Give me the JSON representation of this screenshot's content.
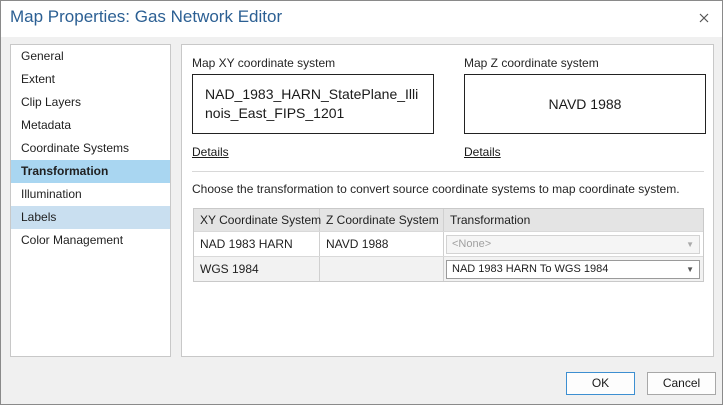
{
  "window": {
    "title": "Map Properties: Gas Network Editor",
    "close_icon": "close-icon"
  },
  "sidebar": {
    "items": [
      {
        "label": "General"
      },
      {
        "label": "Extent"
      },
      {
        "label": "Clip Layers"
      },
      {
        "label": "Metadata"
      },
      {
        "label": "Coordinate Systems"
      },
      {
        "label": "Transformation",
        "state": "selected"
      },
      {
        "label": "Illumination"
      },
      {
        "label": "Labels",
        "state": "hover"
      },
      {
        "label": "Color Management"
      }
    ]
  },
  "main": {
    "xy": {
      "label": "Map XY coordinate system",
      "value": "NAD_1983_HARN_StatePlane_Illinois_East_FIPS_1201",
      "details": "Details"
    },
    "z": {
      "label": "Map Z coordinate system",
      "value": "NAVD 1988",
      "details": "Details"
    },
    "instructions": "Choose the transformation to convert source coordinate systems to map coordinate system.",
    "table": {
      "columns": [
        "XY Coordinate System",
        "Z Coordinate System",
        "Transformation"
      ],
      "rows": [
        {
          "xy": "NAD 1983 HARN",
          "z": "NAVD 1988",
          "transformation": "<None>",
          "enabled": false
        },
        {
          "xy": "WGS 1984",
          "z": "",
          "transformation": "NAD 1983 HARN To WGS 1984",
          "enabled": true
        }
      ]
    }
  },
  "footer": {
    "ok": "OK",
    "cancel": "Cancel"
  },
  "colors": {
    "title": "#2b5f93",
    "selected": "#a9d6f1",
    "hover": "#c9dff0",
    "primary_border": "#3d8fd1"
  }
}
